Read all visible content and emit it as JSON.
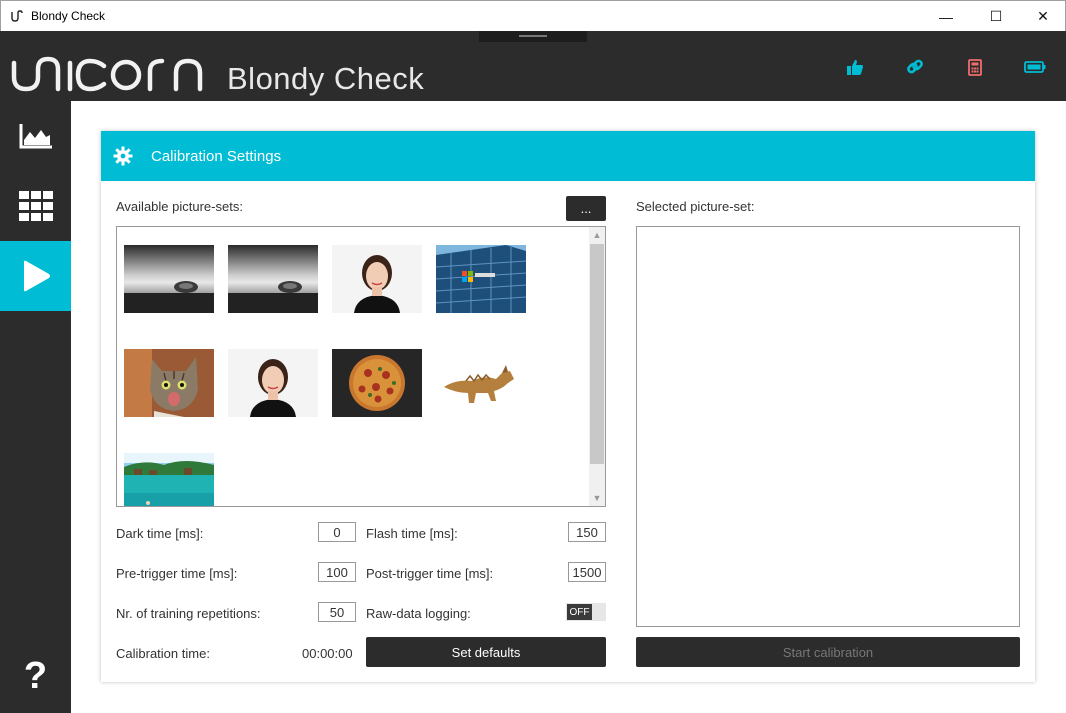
{
  "window": {
    "title": "Blondy Check",
    "minimize": "—",
    "maximize": "☐",
    "close": "✕"
  },
  "header": {
    "logo_icon": "unicorn-logo",
    "brand_title": "Blondy Check",
    "icons": [
      "thumbs-up-icon",
      "link-icon",
      "calculator-icon",
      "battery-icon"
    ],
    "icon_colors": {
      "thumbs": "#00bcd4",
      "link": "#00bcd4",
      "calculator": "#f06d6d",
      "battery": "#00bcd4"
    }
  },
  "sidebar": {
    "items": [
      "chart-icon",
      "grid-icon",
      "play-icon"
    ],
    "active_index": 2,
    "help": "?"
  },
  "card": {
    "title": "Calibration Settings",
    "available_label": "Available picture-sets:",
    "more_button": "...",
    "selected_label": "Selected picture-set:",
    "thumbnails": [
      "beach-bw",
      "beach-bw",
      "woman-portrait",
      "office-building",
      "kitten",
      "woman-portrait",
      "pizza",
      "dinosaur-toy",
      "tropical-sea"
    ]
  },
  "settings": {
    "dark_time_label": "Dark time [ms]:",
    "dark_time_value": "0",
    "flash_time_label": "Flash time [ms]:",
    "flash_time_value": "150",
    "pre_trigger_label": "Pre-trigger time [ms]:",
    "pre_trigger_value": "100",
    "post_trigger_label": "Post-trigger time [ms]:",
    "post_trigger_value": "1500",
    "repetitions_label": "Nr. of training repetitions:",
    "repetitions_value": "50",
    "raw_logging_label": "Raw-data logging:",
    "raw_logging_state": "OFF",
    "calibration_time_label": "Calibration time:",
    "calibration_time_value": "00:00:00",
    "set_defaults_button": "Set defaults",
    "start_calibration_button": "Start calibration"
  },
  "colors": {
    "accent": "#00bcd4",
    "dark": "#2c2c2c"
  }
}
